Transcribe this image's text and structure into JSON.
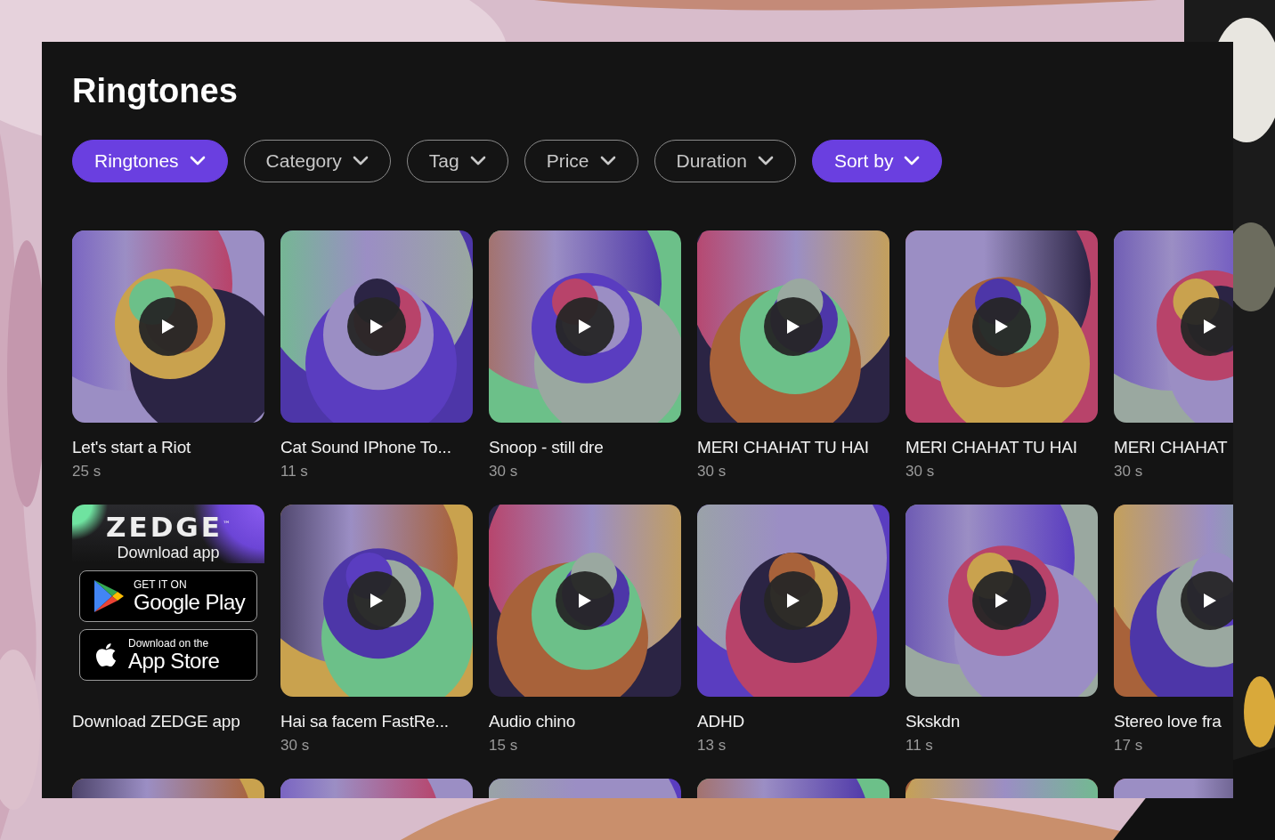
{
  "page": {
    "title": "Ringtones"
  },
  "filters": [
    {
      "label": "Ringtones",
      "selected": true
    },
    {
      "label": "Category",
      "selected": false
    },
    {
      "label": "Tag",
      "selected": false
    },
    {
      "label": "Price",
      "selected": false
    },
    {
      "label": "Duration",
      "selected": false
    },
    {
      "label": "Sort by",
      "selected": true
    }
  ],
  "items": [
    {
      "kind": "track",
      "title": "Let's start a Riot",
      "duration": "25 s"
    },
    {
      "kind": "track",
      "title": "Cat Sound IPhone To...",
      "duration": "11 s"
    },
    {
      "kind": "track",
      "title": "Snoop - still dre",
      "duration": "30 s"
    },
    {
      "kind": "track",
      "title": "MERI CHAHAT TU HAI",
      "duration": "30 s"
    },
    {
      "kind": "track",
      "title": "MERI CHAHAT TU HAI",
      "duration": "30 s"
    },
    {
      "kind": "track",
      "title": "MERI CHAHAT",
      "duration": "30 s"
    },
    {
      "kind": "promo",
      "logo": "ZEDGE$^{™}$",
      "tagline": "Download app",
      "google_small": "GET IT ON",
      "google_big": "Google Play",
      "apple_small": "Download on the",
      "apple_big": "App Store",
      "title": "Download ZEDGE app"
    },
    {
      "kind": "track",
      "title": "Hai sa facem FastRe...",
      "duration": "30 s"
    },
    {
      "kind": "track",
      "title": "Audio chino",
      "duration": "15 s"
    },
    {
      "kind": "track",
      "title": "ADHD",
      "duration": "13 s"
    },
    {
      "kind": "track",
      "title": "Skskdn",
      "duration": "11 s"
    },
    {
      "kind": "track",
      "title": "Stereo love fra",
      "duration": "17 s"
    },
    {
      "kind": "cover"
    },
    {
      "kind": "cover"
    },
    {
      "kind": "cover"
    },
    {
      "kind": "cover"
    },
    {
      "kind": "cover"
    },
    {
      "kind": "cover"
    }
  ]
}
